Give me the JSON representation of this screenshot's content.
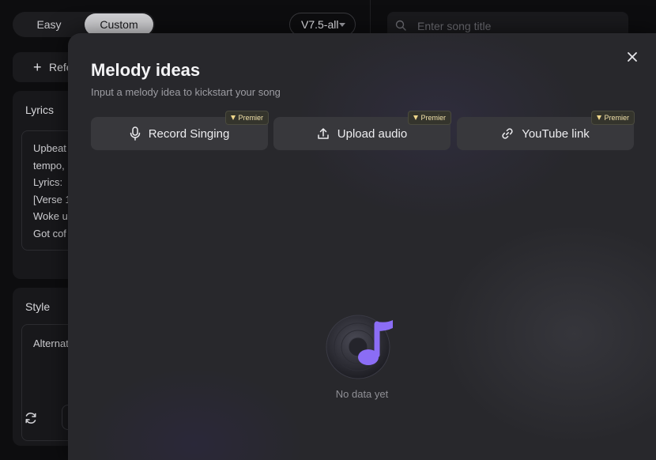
{
  "background": {
    "mode_toggle": {
      "easy": "Easy",
      "custom": "Custom",
      "selected": "Custom"
    },
    "version_select": {
      "value": "V7.5-all"
    },
    "song_search": {
      "placeholder": "Enter song title"
    },
    "reference_button": {
      "label": "Refe"
    },
    "lyrics_card": {
      "title": "Lyrics",
      "lines": [
        "Upbeat",
        "tempo,",
        "Lyrics:",
        "[Verse 1",
        "Woke u",
        "Got cof"
      ]
    },
    "style_card": {
      "title": "Style",
      "text": "Alternat"
    }
  },
  "modal": {
    "title": "Melody ideas",
    "subtitle": "Input a melody idea to kickstart your song",
    "options": [
      {
        "label": "Record Singing",
        "icon": "microphone-icon",
        "badge": "Premier"
      },
      {
        "label": "Upload audio",
        "icon": "upload-icon",
        "badge": "Premier"
      },
      {
        "label": "YouTube link",
        "icon": "link-icon",
        "badge": "Premier"
      }
    ],
    "empty_state": {
      "text": "No data yet",
      "icon": "music-disc-icon"
    }
  },
  "colors": {
    "accent": "#8b6df5",
    "premium": "#f0d78a"
  }
}
